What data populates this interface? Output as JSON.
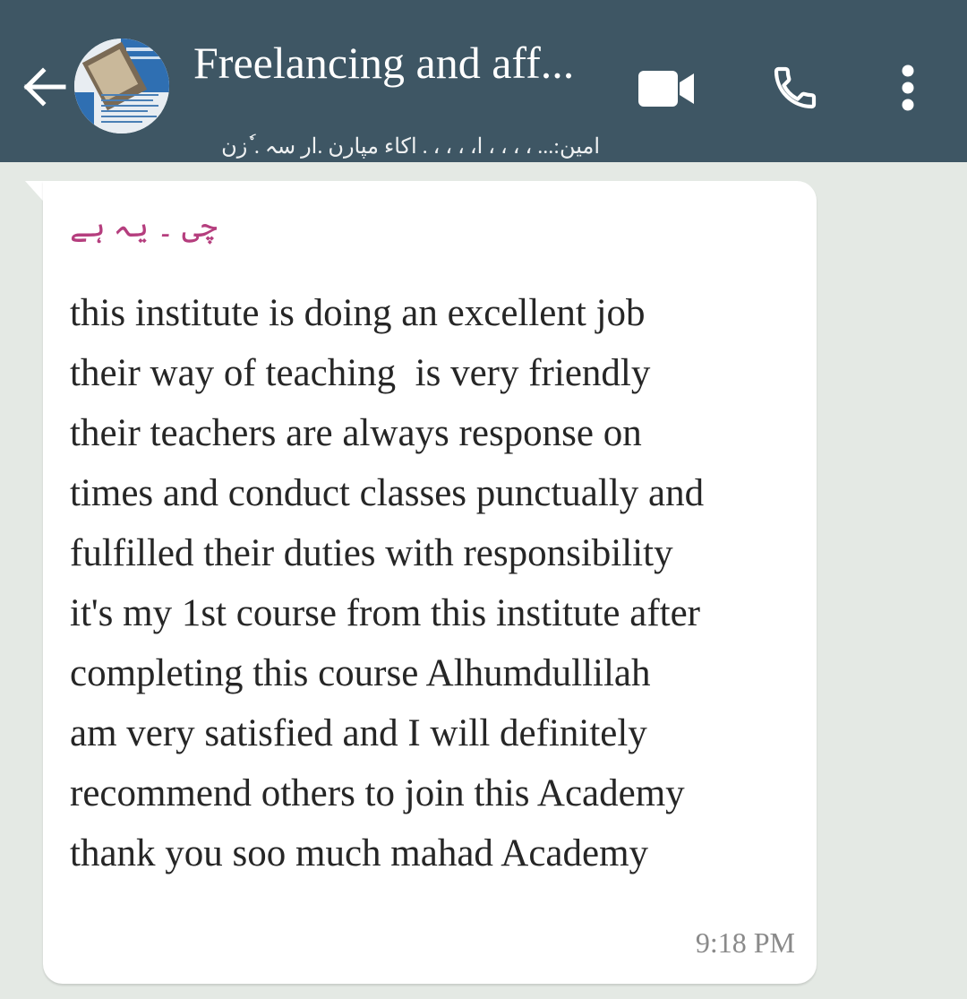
{
  "header": {
    "chat_title": "Freelancing and aff...",
    "subtitle": "امین:... ، ، ، ، ا، ، ، ، . اکاء مپارن .ار سہ . ٗزن",
    "icons": {
      "back": "arrow-back-icon",
      "video": "video-camera-icon",
      "call": "phone-icon",
      "more": "more-vertical-icon"
    },
    "colors": {
      "bar": "#3e5664",
      "icon": "#ffffff"
    }
  },
  "message": {
    "sender": "چی ۔ یہ ہے",
    "lines": [
      "this institute is doing an excellent job",
      "their way of teaching  is very friendly",
      "their teachers are always response on",
      "times and conduct classes punctually and",
      "fulfilled their duties with responsibility",
      "it's my 1st course from this institute after",
      "completing this course Alhumdullilah",
      "am very satisfied and I will definitely",
      "recommend others to join this Academy",
      "thank you soo much mahad Academy"
    ],
    "time": "9:18 PM",
    "colors": {
      "sender": "#b53e7e",
      "bubble": "#ffffff",
      "text": "#262626",
      "time": "#8a8a8a"
    }
  },
  "chat_background": "#e4e9e4"
}
